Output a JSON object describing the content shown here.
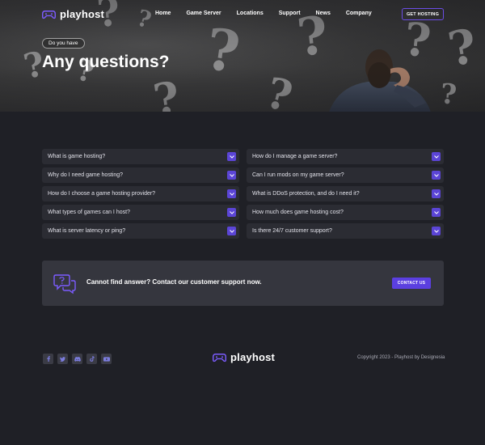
{
  "brand": {
    "name": "playhost",
    "accent": "#5b45d6"
  },
  "nav": {
    "links": [
      "Home",
      "Game Server",
      "Locations",
      "Support",
      "News",
      "Company"
    ],
    "cta": "GET HOSTING"
  },
  "hero": {
    "pill": "Do you have",
    "title": "Any questions?"
  },
  "faq": {
    "left": [
      "What is game hosting?",
      "Why do I need game hosting?",
      "How do I choose a game hosting provider?",
      "What types of games can I host?",
      "What is server latency or ping?"
    ],
    "right": [
      "How do I manage a game server?",
      "Can I run mods on my game server?",
      "What is DDoS protection, and do I need it?",
      "How much does game hosting cost?",
      "Is there 24/7 customer support?"
    ],
    "toggle_icon": "chevron-down-icon"
  },
  "support": {
    "text": "Cannot find answer? Contact our customer support now.",
    "button": "CONTACT US",
    "icon": "chat-question-icon"
  },
  "footer": {
    "socials": [
      "facebook-icon",
      "twitter-icon",
      "discord-icon",
      "tiktok-icon",
      "youtube-icon"
    ],
    "copyright": "Copyright 2023 - Playhost by Designesia"
  }
}
